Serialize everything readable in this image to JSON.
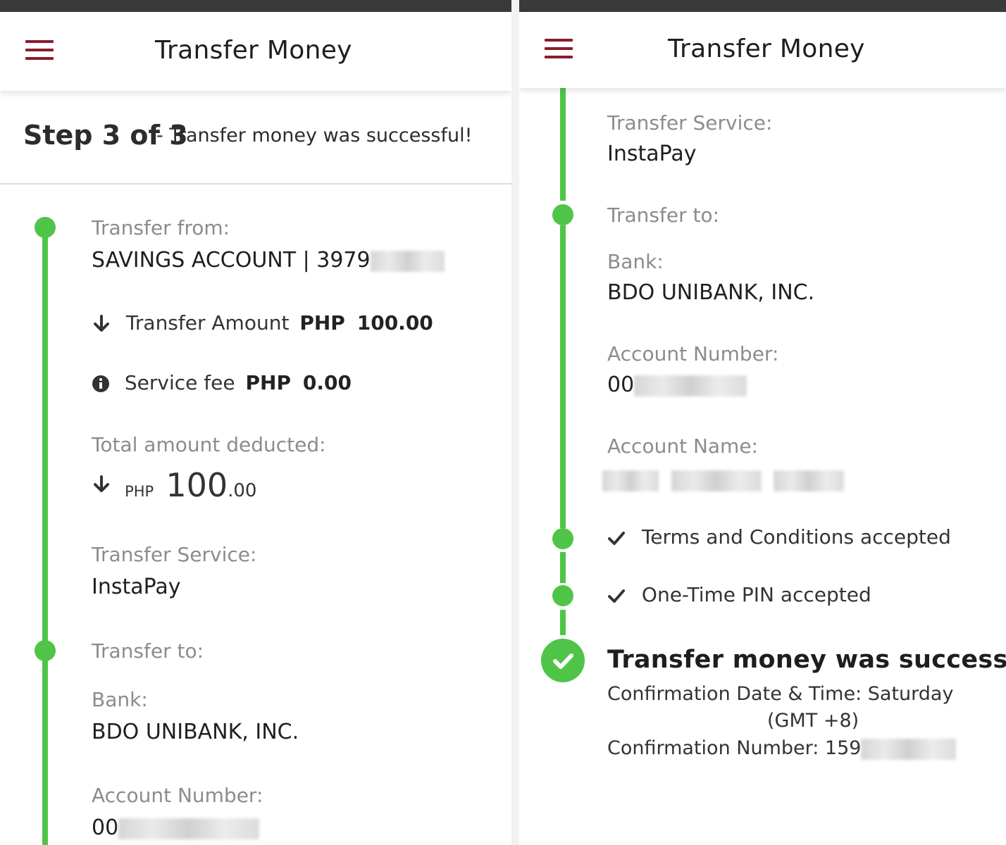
{
  "left_screen": {
    "header": {
      "title": "Transfer Money"
    },
    "step": {
      "label": "Step 3 of 3",
      "message": "- Transfer money was successful!"
    },
    "transfer_from": {
      "label": "Transfer from:",
      "value": "SAVINGS ACCOUNT | 3979"
    },
    "transfer_amount": {
      "label": "Transfer Amount",
      "currency": "PHP",
      "amount": "100.00"
    },
    "service_fee": {
      "label": "Service fee",
      "currency": "PHP",
      "amount": "0.00"
    },
    "total_deducted": {
      "label": "Total amount deducted:",
      "currency": "PHP",
      "whole": "100",
      "decimals": ".00"
    },
    "transfer_service": {
      "label": "Transfer Service:",
      "value": "InstaPay"
    },
    "transfer_to": {
      "label": "Transfer to:"
    },
    "bank": {
      "label": "Bank:",
      "value": "BDO UNIBANK, INC."
    },
    "account_number": {
      "label": "Account Number:",
      "value": "00"
    }
  },
  "right_screen": {
    "header": {
      "title": "Transfer Money"
    },
    "transfer_service": {
      "label": "Transfer Service:",
      "value": "InstaPay"
    },
    "transfer_to": {
      "label": "Transfer to:"
    },
    "bank": {
      "label": "Bank:",
      "value": "BDO UNIBANK, INC."
    },
    "account_number": {
      "label": "Account Number:",
      "value": "00"
    },
    "account_name": {
      "label": "Account Name:"
    },
    "terms": "Terms and Conditions accepted",
    "otp": "One-Time PIN accepted",
    "success": {
      "title": "Transfer money was successful!",
      "confirmation_datetime": "Confirmation Date & Time: Saturday",
      "timezone": "(GMT +8)",
      "confirmation_number": "Confirmation Number: 159"
    }
  },
  "colors": {
    "accent_green": "#4fc548",
    "menu_red": "#8a1c2b",
    "label_gray": "#8c8c8c"
  },
  "icons": [
    "menu-icon",
    "arrow-down-icon",
    "info-icon",
    "checkmark-icon",
    "success-check-icon"
  ]
}
